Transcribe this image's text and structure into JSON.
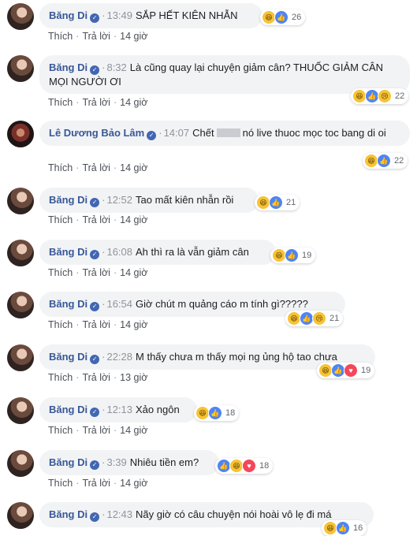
{
  "labels": {
    "like": "Thích",
    "reply": "Trả lời",
    "separator": "·"
  },
  "comments": [
    {
      "name": "Băng Di",
      "time": "13:49",
      "text": "SẮP HẾT KIÊN NHẪN",
      "ago": "14 giờ",
      "count": "26",
      "reactions": [
        "haha",
        "like"
      ]
    },
    {
      "name": "Băng Di",
      "time": "8:32",
      "text": "Là cũng quay lại chuyện giảm cân? THUỐC GIẢM CÂN MỌI NGƯỜI ƠI",
      "ago": "14 giờ",
      "count": "22",
      "reactions": [
        "haha",
        "like",
        "sad"
      ]
    },
    {
      "name": "Lê Dương Bảo Lâm",
      "time": "14:07",
      "text_before": "Chết",
      "text_after": "nó live thuoc mọc toc bang di oi",
      "ago": "14 giờ",
      "count": "22",
      "reactions": [
        "haha",
        "like"
      ]
    },
    {
      "name": "Băng Di",
      "time": "12:52",
      "text": "Tao mất kiên nhẫn rồi",
      "ago": "14 giờ",
      "count": "21",
      "reactions": [
        "haha",
        "like"
      ]
    },
    {
      "name": "Băng Di",
      "time": "16:08",
      "text": "Ah thì ra là vẫn giảm cân",
      "ago": "14 giờ",
      "count": "19",
      "reactions": [
        "haha",
        "like"
      ]
    },
    {
      "name": "Băng Di",
      "time": "16:54",
      "text": "Giờ chút m quảng cáo m tính gì?????",
      "ago": "14 giờ",
      "count": "21",
      "reactions": [
        "haha",
        "like",
        "sad"
      ]
    },
    {
      "name": "Băng Di",
      "time": "22:28",
      "text": "M thấy chưa m thấy mọi ng ủng hộ tao chưa",
      "ago": "13 giờ",
      "count": "19",
      "reactions": [
        "haha",
        "like",
        "love"
      ]
    },
    {
      "name": "Băng Di",
      "time": "12:13",
      "text": "Xảo ngôn",
      "ago": "14 giờ",
      "count": "18",
      "reactions": [
        "haha",
        "like"
      ]
    },
    {
      "name": "Băng Di",
      "time": "3:39",
      "text": "Nhiêu tiền em?",
      "ago": "14 giờ",
      "count": "18",
      "reactions": [
        "like",
        "haha",
        "love"
      ]
    },
    {
      "name": "Băng Di",
      "time": "12:43",
      "text": "Nãy giờ có câu chuyện nói hoài vô lẹ đi má",
      "ago": "",
      "count": "16",
      "reactions": [
        "haha",
        "like"
      ]
    }
  ]
}
